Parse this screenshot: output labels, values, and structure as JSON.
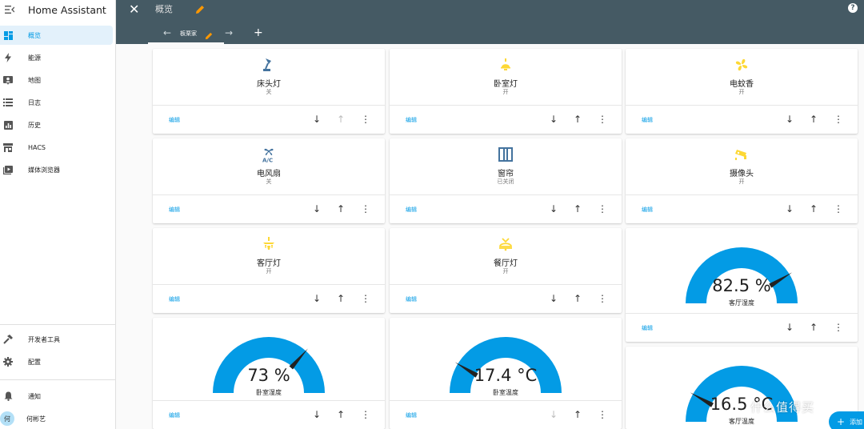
{
  "app": {
    "title": "Home Assistant"
  },
  "sidebar": {
    "items": [
      {
        "label": "概览",
        "icon": "dashboard-icon",
        "active": true
      },
      {
        "label": "能源",
        "icon": "lightning-icon"
      },
      {
        "label": "地图",
        "icon": "map-icon"
      },
      {
        "label": "日志",
        "icon": "list-icon"
      },
      {
        "label": "历史",
        "icon": "chart-icon"
      },
      {
        "label": "HACS",
        "icon": "hacs-icon"
      },
      {
        "label": "媒体浏览器",
        "icon": "media-icon"
      }
    ],
    "bottom": [
      {
        "label": "开发者工具",
        "icon": "hammer-icon"
      },
      {
        "label": "配置",
        "icon": "gear-icon"
      },
      {
        "label": "通知",
        "icon": "bell-icon"
      },
      {
        "label": "何彬艺",
        "icon": "avatar-icon",
        "avatar_text": "何"
      }
    ]
  },
  "header": {
    "title": "概览",
    "tab_label": "板栗家",
    "close_icon": "close-icon",
    "help_icon": "help-icon",
    "add_tab": "+"
  },
  "cards": [
    {
      "name": "床头灯",
      "state": "关",
      "icon": "desk-lamp-icon",
      "edit": "编辑",
      "up_disabled": true,
      "down_disabled": false
    },
    {
      "name": "卧室灯",
      "state": "开",
      "icon": "ceiling-light-icon",
      "edit": "编辑"
    },
    {
      "name": "电蚊香",
      "state": "开",
      "icon": "fan-icon",
      "edit": "编辑"
    },
    {
      "name": "电风扇",
      "state": "关",
      "icon": "air-conditioner-icon",
      "edit": "编辑"
    },
    {
      "name": "窗帘",
      "state": "已关闭",
      "icon": "curtain-icon",
      "edit": "编辑"
    },
    {
      "name": "摄像头",
      "state": "开",
      "icon": "camera-icon",
      "edit": "编辑"
    },
    {
      "name": "客厅灯",
      "state": "开",
      "icon": "chandelier-icon",
      "edit": "编辑"
    },
    {
      "name": "餐厅灯",
      "state": "开",
      "icon": "dining-light-icon",
      "edit": "编辑"
    }
  ],
  "gauges": [
    {
      "value": "82.5 %",
      "fraction": 0.825,
      "name": "客厅湿度",
      "edit": "编辑"
    },
    {
      "value": "73 %",
      "fraction": 0.73,
      "name": "卧室湿度",
      "edit": "编辑"
    },
    {
      "value": "17.4 °C",
      "fraction": 0.174,
      "name": "卧室温度",
      "edit": "编辑",
      "down_disabled": true
    },
    {
      "value": "16.5 °C",
      "fraction": 0.165,
      "name": "客厅温度"
    }
  ],
  "fab": {
    "label": "添加"
  },
  "watermark": "什么值得买",
  "colors": {
    "accent": "#039be5",
    "header": "#455a64",
    "icon_on": "#fdd835",
    "icon_off": "#44739e",
    "gauge": "#039be5"
  }
}
